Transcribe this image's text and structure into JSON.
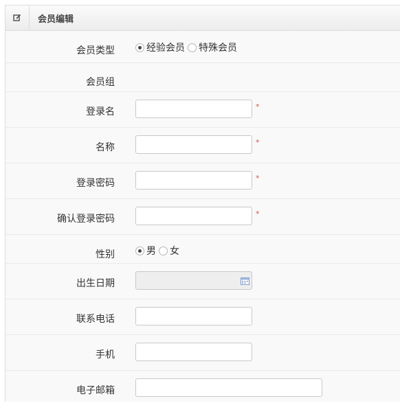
{
  "panel": {
    "title": "会员编辑",
    "icon": "edit-icon"
  },
  "fields": {
    "member_type": {
      "label": "会员类型",
      "options": [
        "经验会员",
        "特殊会员"
      ],
      "selected": "经验会员"
    },
    "member_group": {
      "label": "会员组",
      "value": ""
    },
    "login_name": {
      "label": "登录名",
      "value": "",
      "required": "*"
    },
    "name": {
      "label": "名称",
      "value": "",
      "required": "*"
    },
    "password": {
      "label": "登录密码",
      "value": "",
      "required": "*"
    },
    "confirm_password": {
      "label": "确认登录密码",
      "value": "",
      "required": "*"
    },
    "gender": {
      "label": "性别",
      "options": [
        "男",
        "女"
      ],
      "selected": "男"
    },
    "birthday": {
      "label": "出生日期",
      "value": "",
      "icon": "calendar-icon"
    },
    "phone": {
      "label": "联系电话",
      "value": ""
    },
    "mobile": {
      "label": "手机",
      "value": ""
    },
    "email": {
      "label": "电子邮箱",
      "value": ""
    }
  }
}
